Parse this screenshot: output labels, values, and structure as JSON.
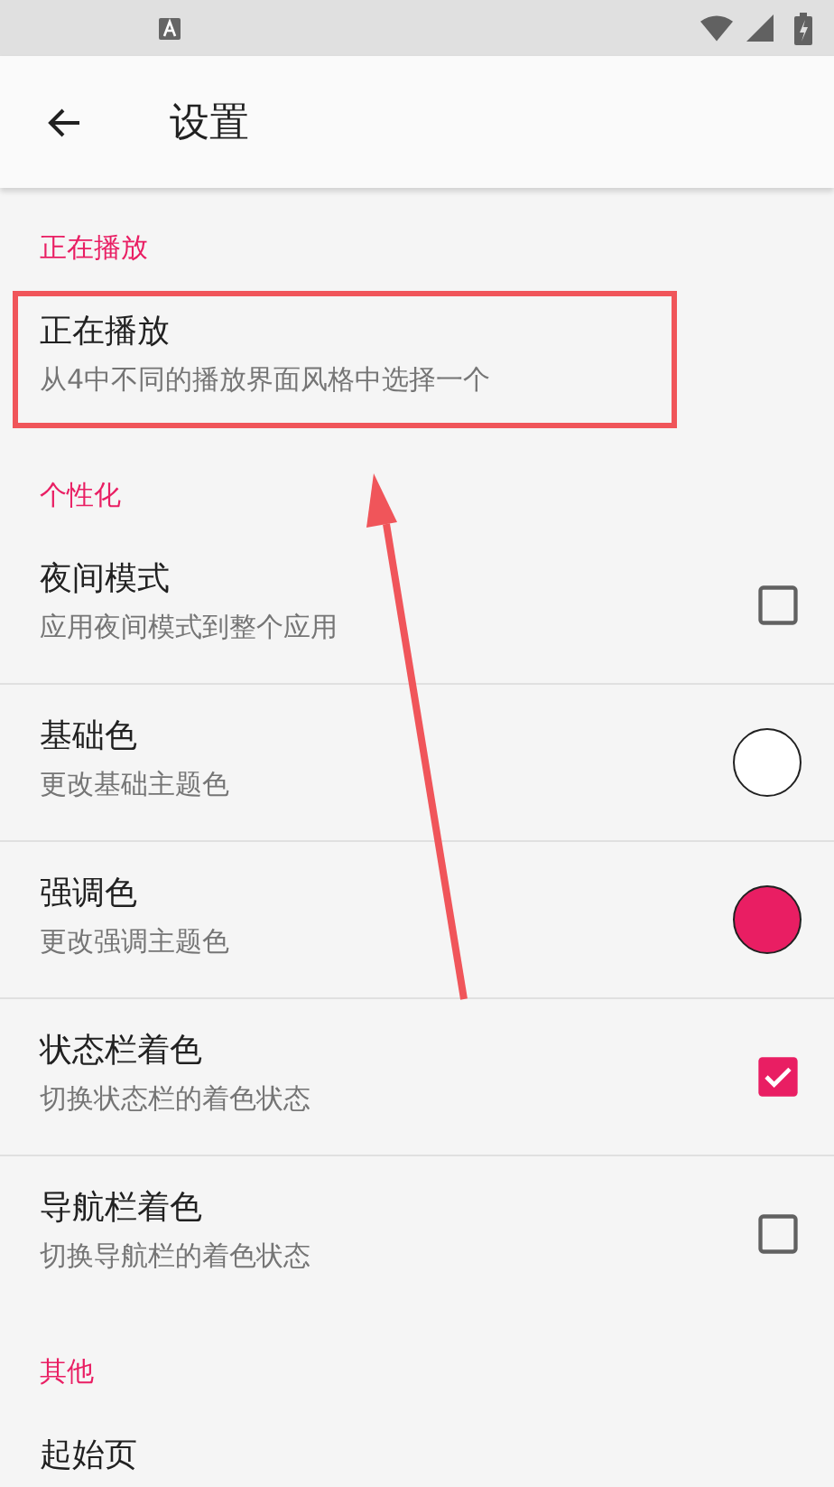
{
  "toolbar": {
    "title": "设置"
  },
  "sections": [
    {
      "header": "正在播放",
      "items": [
        {
          "kind": "plain",
          "title": "正在播放",
          "summary": "从4中不同的播放界面风格中选择一个",
          "highlighted": true
        }
      ]
    },
    {
      "header": "个性化",
      "items": [
        {
          "kind": "checkbox",
          "title": "夜间模式",
          "summary": "应用夜间模式到整个应用",
          "checked": false
        },
        {
          "kind": "color",
          "title": "基础色",
          "summary": "更改基础主题色",
          "color": "#ffffff"
        },
        {
          "kind": "color",
          "title": "强调色",
          "summary": "更改强调主题色",
          "color": "#e91e63"
        },
        {
          "kind": "checkbox",
          "title": "状态栏着色",
          "summary": "切换状态栏的着色状态",
          "checked": true
        },
        {
          "kind": "checkbox",
          "title": "导航栏着色",
          "summary": "切换导航栏的着色状态",
          "checked": false
        }
      ]
    },
    {
      "header": "其他",
      "items": [
        {
          "kind": "plain",
          "title": "起始页"
        }
      ]
    }
  ]
}
